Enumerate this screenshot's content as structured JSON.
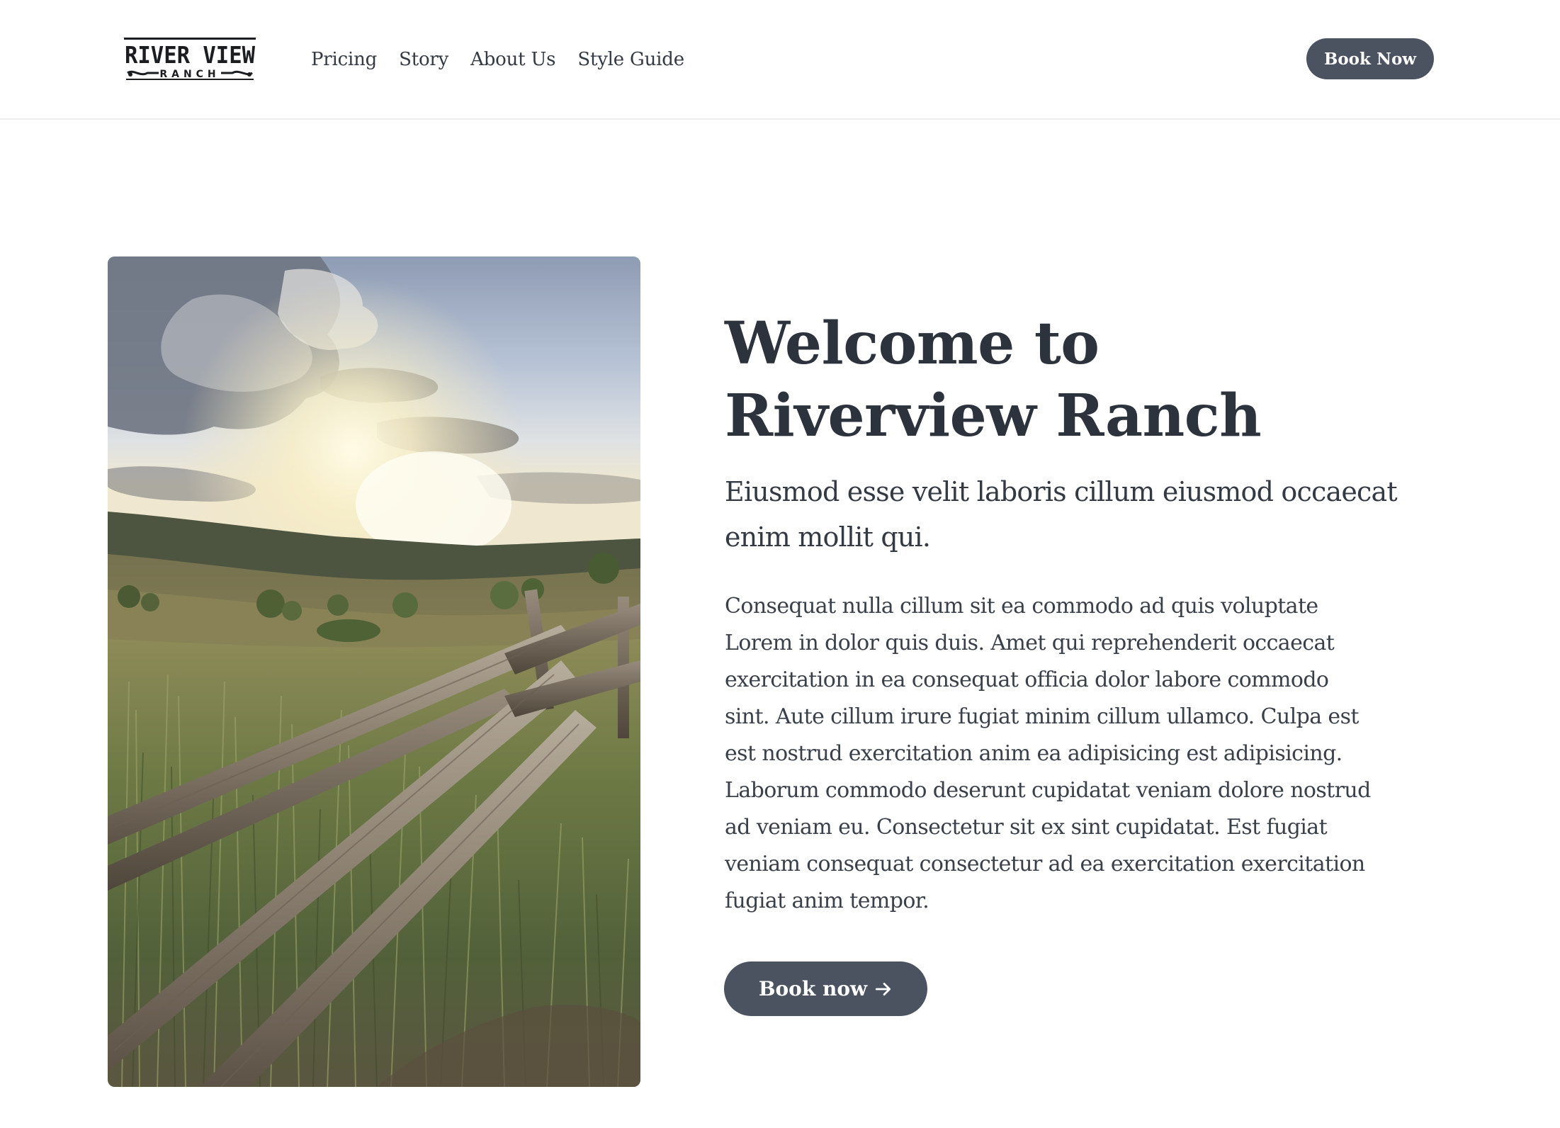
{
  "header": {
    "logo": {
      "title": "RIVER VIEW",
      "subtitle": "RANCH"
    },
    "nav": [
      {
        "label": "Pricing"
      },
      {
        "label": "Story"
      },
      {
        "label": "About Us"
      },
      {
        "label": "Style Guide"
      }
    ],
    "book_button_label": "Book Now"
  },
  "hero": {
    "image_icon": "ranch-sunset-fence-photo",
    "title": "Welcome to Riverview Ranch",
    "subtitle": "Eiusmod esse velit laboris cillum eiusmod occaecat enim mollit qui.",
    "body": "Consequat nulla cillum sit ea commodo ad quis voluptate Lorem in dolor quis duis. Amet qui reprehenderit occaecat exercitation in ea consequat officia dolor labore commodo sint. Aute cillum irure fugiat minim cillum ullamco. Culpa est est nostrud exercitation anim ea adipisicing est adipisicing. Laborum commodo deserunt cupidatat veniam dolore nostrud ad veniam eu. Consectetur sit ex sint cupidatat. Est fugiat veniam consequat consectetur ad ea exercitation exercitation fugiat anim tempor.",
    "cta_label": "Book now",
    "cta_icon": "arrow-right-icon"
  },
  "colors": {
    "button_bg": "#4a535f",
    "text_dark": "#2d333c",
    "header_border": "#eceeef"
  }
}
